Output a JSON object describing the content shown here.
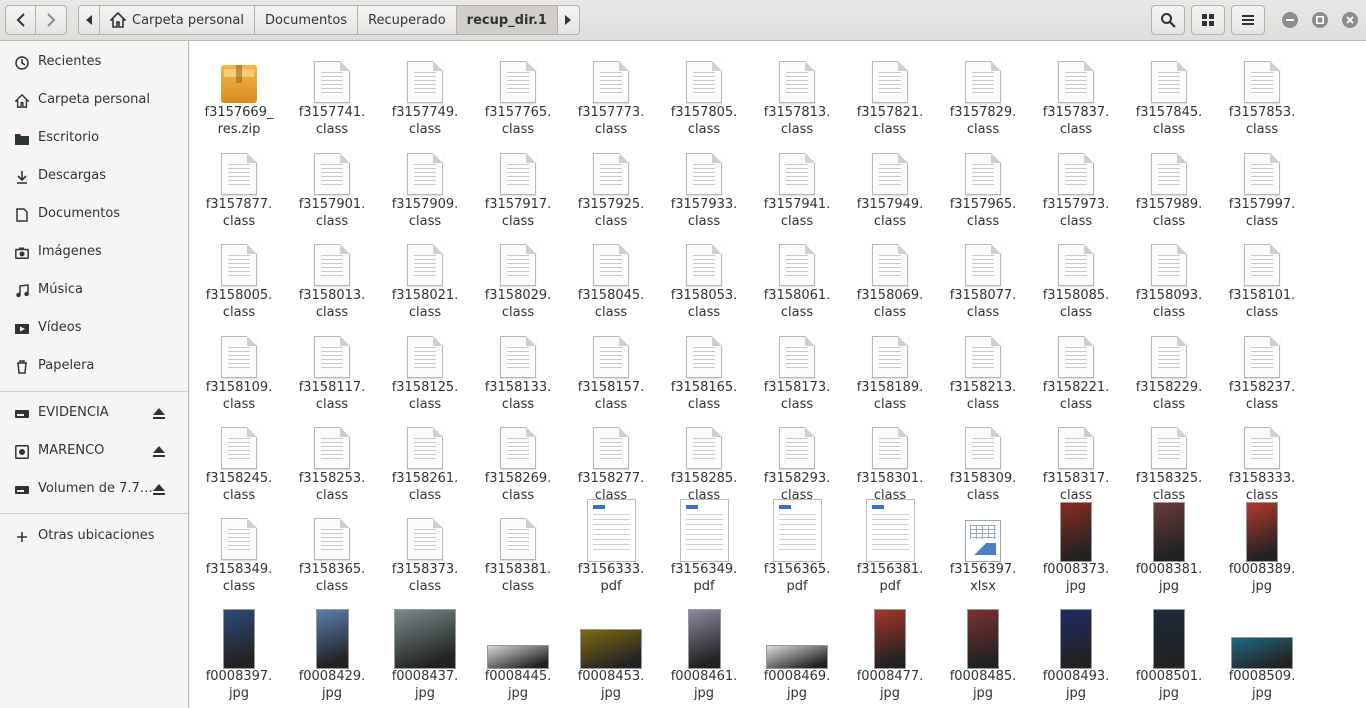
{
  "pathbar": {
    "crumbs": [
      "Carpeta personal",
      "Documentos",
      "Recuperado",
      "recup_dir.1"
    ]
  },
  "sidebar": {
    "places": [
      {
        "label": "Recientes",
        "icon": "clock-icon"
      },
      {
        "label": "Carpeta personal",
        "icon": "home-icon"
      },
      {
        "label": "Escritorio",
        "icon": "folder-icon"
      },
      {
        "label": "Descargas",
        "icon": "download-icon"
      },
      {
        "label": "Documentos",
        "icon": "document-icon"
      },
      {
        "label": "Imágenes",
        "icon": "camera-icon"
      },
      {
        "label": "Música",
        "icon": "music-icon"
      },
      {
        "label": "Vídeos",
        "icon": "video-icon"
      },
      {
        "label": "Papelera",
        "icon": "trash-icon"
      }
    ],
    "devices": [
      {
        "label": "EVIDENCIA",
        "icon": "drive-icon"
      },
      {
        "label": "MARENCO",
        "icon": "camera-drive-icon"
      },
      {
        "label": "Volumen de 7.7…",
        "icon": "drive-icon"
      }
    ],
    "other": {
      "label": "Otras ubicaciones",
      "icon": "plus-icon"
    }
  },
  "files": [
    {
      "l1": "f3157669_",
      "l2": "res.zip",
      "kind": "zip"
    },
    {
      "l1": "f3157741.",
      "l2": "class",
      "kind": "doc"
    },
    {
      "l1": "f3157749.",
      "l2": "class",
      "kind": "doc"
    },
    {
      "l1": "f3157765.",
      "l2": "class",
      "kind": "doc"
    },
    {
      "l1": "f3157773.",
      "l2": "class",
      "kind": "doc"
    },
    {
      "l1": "f3157805.",
      "l2": "class",
      "kind": "doc"
    },
    {
      "l1": "f3157813.",
      "l2": "class",
      "kind": "doc"
    },
    {
      "l1": "f3157821.",
      "l2": "class",
      "kind": "doc"
    },
    {
      "l1": "f3157829.",
      "l2": "class",
      "kind": "doc"
    },
    {
      "l1": "f3157837.",
      "l2": "class",
      "kind": "doc"
    },
    {
      "l1": "f3157845.",
      "l2": "class",
      "kind": "doc"
    },
    {
      "l1": "f3157853.",
      "l2": "class",
      "kind": "doc"
    },
    {
      "l1": "f3157877.",
      "l2": "class",
      "kind": "doc"
    },
    {
      "l1": "f3157901.",
      "l2": "class",
      "kind": "doc"
    },
    {
      "l1": "f3157909.",
      "l2": "class",
      "kind": "doc"
    },
    {
      "l1": "f3157917.",
      "l2": "class",
      "kind": "doc"
    },
    {
      "l1": "f3157925.",
      "l2": "class",
      "kind": "doc"
    },
    {
      "l1": "f3157933.",
      "l2": "class",
      "kind": "doc"
    },
    {
      "l1": "f3157941.",
      "l2": "class",
      "kind": "doc"
    },
    {
      "l1": "f3157949.",
      "l2": "class",
      "kind": "doc"
    },
    {
      "l1": "f3157965.",
      "l2": "class",
      "kind": "doc"
    },
    {
      "l1": "f3157973.",
      "l2": "class",
      "kind": "doc"
    },
    {
      "l1": "f3157989.",
      "l2": "class",
      "kind": "doc"
    },
    {
      "l1": "f3157997.",
      "l2": "class",
      "kind": "doc"
    },
    {
      "l1": "f3158005.",
      "l2": "class",
      "kind": "doc"
    },
    {
      "l1": "f3158013.",
      "l2": "class",
      "kind": "doc"
    },
    {
      "l1": "f3158021.",
      "l2": "class",
      "kind": "doc"
    },
    {
      "l1": "f3158029.",
      "l2": "class",
      "kind": "doc"
    },
    {
      "l1": "f3158045.",
      "l2": "class",
      "kind": "doc"
    },
    {
      "l1": "f3158053.",
      "l2": "class",
      "kind": "doc"
    },
    {
      "l1": "f3158061.",
      "l2": "class",
      "kind": "doc"
    },
    {
      "l1": "f3158069.",
      "l2": "class",
      "kind": "doc"
    },
    {
      "l1": "f3158077.",
      "l2": "class",
      "kind": "doc"
    },
    {
      "l1": "f3158085.",
      "l2": "class",
      "kind": "doc"
    },
    {
      "l1": "f3158093.",
      "l2": "class",
      "kind": "doc"
    },
    {
      "l1": "f3158101.",
      "l2": "class",
      "kind": "doc"
    },
    {
      "l1": "f3158109.",
      "l2": "class",
      "kind": "doc"
    },
    {
      "l1": "f3158117.",
      "l2": "class",
      "kind": "doc"
    },
    {
      "l1": "f3158125.",
      "l2": "class",
      "kind": "doc"
    },
    {
      "l1": "f3158133.",
      "l2": "class",
      "kind": "doc"
    },
    {
      "l1": "f3158157.",
      "l2": "class",
      "kind": "doc"
    },
    {
      "l1": "f3158165.",
      "l2": "class",
      "kind": "doc"
    },
    {
      "l1": "f3158173.",
      "l2": "class",
      "kind": "doc"
    },
    {
      "l1": "f3158189.",
      "l2": "class",
      "kind": "doc"
    },
    {
      "l1": "f3158213.",
      "l2": "class",
      "kind": "doc"
    },
    {
      "l1": "f3158221.",
      "l2": "class",
      "kind": "doc"
    },
    {
      "l1": "f3158229.",
      "l2": "class",
      "kind": "doc"
    },
    {
      "l1": "f3158237.",
      "l2": "class",
      "kind": "doc"
    },
    {
      "l1": "f3158245.",
      "l2": "class",
      "kind": "doc"
    },
    {
      "l1": "f3158253.",
      "l2": "class",
      "kind": "doc"
    },
    {
      "l1": "f3158261.",
      "l2": "class",
      "kind": "doc"
    },
    {
      "l1": "f3158269.",
      "l2": "class",
      "kind": "doc"
    },
    {
      "l1": "f3158277.",
      "l2": "class",
      "kind": "doc"
    },
    {
      "l1": "f3158285.",
      "l2": "class",
      "kind": "doc"
    },
    {
      "l1": "f3158293.",
      "l2": "class",
      "kind": "doc"
    },
    {
      "l1": "f3158301.",
      "l2": "class",
      "kind": "doc"
    },
    {
      "l1": "f3158309.",
      "l2": "class",
      "kind": "doc"
    },
    {
      "l1": "f3158317.",
      "l2": "class",
      "kind": "doc"
    },
    {
      "l1": "f3158325.",
      "l2": "class",
      "kind": "doc"
    },
    {
      "l1": "f3158333.",
      "l2": "class",
      "kind": "doc"
    },
    {
      "l1": "f3158349.",
      "l2": "class",
      "kind": "doc"
    },
    {
      "l1": "f3158365.",
      "l2": "class",
      "kind": "doc"
    },
    {
      "l1": "f3158373.",
      "l2": "class",
      "kind": "doc"
    },
    {
      "l1": "f3158381.",
      "l2": "class",
      "kind": "doc"
    },
    {
      "l1": "f3156333.",
      "l2": "pdf",
      "kind": "pdf"
    },
    {
      "l1": "f3156349.",
      "l2": "pdf",
      "kind": "pdf"
    },
    {
      "l1": "f3156365.",
      "l2": "pdf",
      "kind": "pdf"
    },
    {
      "l1": "f3156381.",
      "l2": "pdf",
      "kind": "pdf"
    },
    {
      "l1": "f3156397.",
      "l2": "xlsx",
      "kind": "xlsx"
    },
    {
      "l1": "f0008373.",
      "l2": "jpg",
      "kind": "photo",
      "w": 32,
      "h": 60,
      "color": "#8b2a22"
    },
    {
      "l1": "f0008381.",
      "l2": "jpg",
      "kind": "photo",
      "w": 32,
      "h": 60,
      "color": "#6a3a3a"
    },
    {
      "l1": "f0008389.",
      "l2": "jpg",
      "kind": "photo",
      "w": 32,
      "h": 60,
      "color": "#b03a2e"
    },
    {
      "l1": "f0008397.",
      "l2": "jpg",
      "kind": "photo",
      "w": 32,
      "h": 60,
      "color": "#2c4a78"
    },
    {
      "l1": "f0008429.",
      "l2": "jpg",
      "kind": "photo",
      "w": 33,
      "h": 60,
      "color": "#5a7fb0"
    },
    {
      "l1": "f0008437.",
      "l2": "jpg",
      "kind": "photo",
      "w": 62,
      "h": 60,
      "color": "#7a8a8a"
    },
    {
      "l1": "f0008445.",
      "l2": "jpg",
      "kind": "photo",
      "w": 62,
      "h": 24,
      "color": "#d7d7d7"
    },
    {
      "l1": "f0008453.",
      "l2": "jpg",
      "kind": "photo",
      "w": 62,
      "h": 40,
      "color": "#7d6a12"
    },
    {
      "l1": "f0008461.",
      "l2": "jpg",
      "kind": "photo",
      "w": 33,
      "h": 60,
      "color": "#8a8aa0"
    },
    {
      "l1": "f0008469.",
      "l2": "jpg",
      "kind": "photo",
      "w": 62,
      "h": 24,
      "color": "#dcdcdc"
    },
    {
      "l1": "f0008477.",
      "l2": "jpg",
      "kind": "photo",
      "w": 32,
      "h": 60,
      "color": "#a8352a"
    },
    {
      "l1": "f0008485.",
      "l2": "jpg",
      "kind": "photo",
      "w": 32,
      "h": 60,
      "color": "#7a3030"
    },
    {
      "l1": "f0008493.",
      "l2": "jpg",
      "kind": "photo",
      "w": 32,
      "h": 60,
      "color": "#1e2a66"
    },
    {
      "l1": "f0008501.",
      "l2": "jpg",
      "kind": "photo",
      "w": 32,
      "h": 60,
      "color": "#1a2a3a"
    },
    {
      "l1": "f0008509.",
      "l2": "jpg",
      "kind": "photo",
      "w": 62,
      "h": 32,
      "color": "#1d6a80"
    }
  ]
}
